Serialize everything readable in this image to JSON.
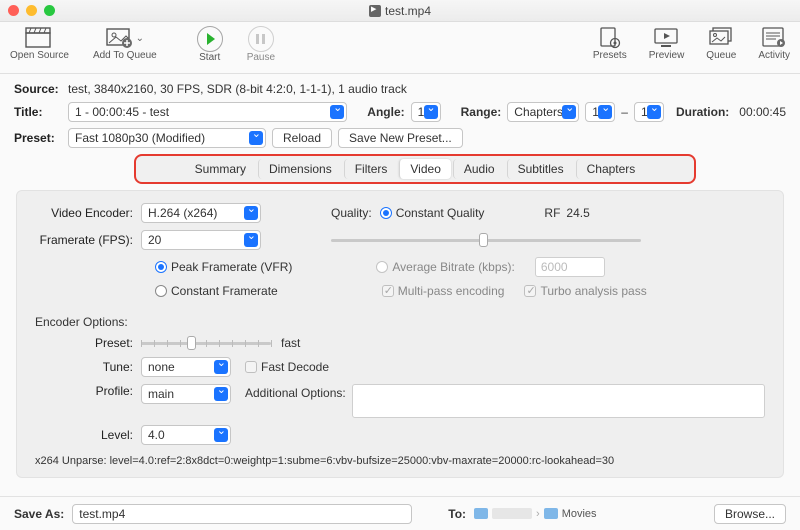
{
  "window": {
    "title": "test.mp4"
  },
  "toolbar": {
    "left": [
      {
        "name": "open-source",
        "label": "Open Source"
      },
      {
        "name": "add-to-queue",
        "label": "Add To Queue"
      }
    ],
    "mid": [
      {
        "name": "start",
        "label": "Start"
      },
      {
        "name": "pause",
        "label": "Pause"
      }
    ],
    "right": [
      {
        "name": "presets",
        "label": "Presets"
      },
      {
        "name": "preview",
        "label": "Preview"
      },
      {
        "name": "queue",
        "label": "Queue"
      },
      {
        "name": "activity",
        "label": "Activity"
      }
    ]
  },
  "source": {
    "label": "Source:",
    "text": "test, 3840x2160, 30 FPS, SDR (8-bit 4:2:0, 1-1-1), 1 audio track"
  },
  "title": {
    "label": "Title:",
    "value": "1 - 00:00:45 - test"
  },
  "angle": {
    "label": "Angle:",
    "value": "1"
  },
  "range": {
    "label": "Range:",
    "mode": "Chapters",
    "from": "1",
    "to": "1",
    "dash": "–"
  },
  "duration": {
    "label": "Duration:",
    "value": "00:00:45"
  },
  "preset": {
    "label": "Preset:",
    "value": "Fast 1080p30 (Modified)",
    "reload": "Reload",
    "saveNew": "Save New Preset..."
  },
  "tabs": [
    "Summary",
    "Dimensions",
    "Filters",
    "Video",
    "Audio",
    "Subtitles",
    "Chapters"
  ],
  "activeTab": "Video",
  "video": {
    "encoderLabel": "Video Encoder:",
    "encoder": "H.264 (x264)",
    "framerateLabel": "Framerate (FPS):",
    "framerate": "20",
    "peak": "Peak Framerate (VFR)",
    "constFr": "Constant Framerate",
    "qualityLabel": "Quality:",
    "cq": "Constant Quality",
    "rfLabel": "RF",
    "rf": "24.5",
    "avg": "Average Bitrate (kbps):",
    "avgVal": "6000",
    "multi": "Multi-pass encoding",
    "turbo": "Turbo analysis pass",
    "encOptsLabel": "Encoder Options:",
    "presetLabel": "Preset:",
    "presetVal": "fast",
    "tuneLabel": "Tune:",
    "tune": "none",
    "fastDecode": "Fast Decode",
    "profileLabel": "Profile:",
    "profile": "main",
    "addOptsLabel": "Additional Options:",
    "levelLabel": "Level:",
    "level": "4.0",
    "unparse": "x264 Unparse: level=4.0:ref=2:8x8dct=0:weightp=1:subme=6:vbv-bufsize=25000:vbv-maxrate=20000:rc-lookahead=30"
  },
  "save": {
    "label": "Save As:",
    "file": "test.mp4",
    "to": "To:",
    "path2": "Movies",
    "browse": "Browse..."
  }
}
